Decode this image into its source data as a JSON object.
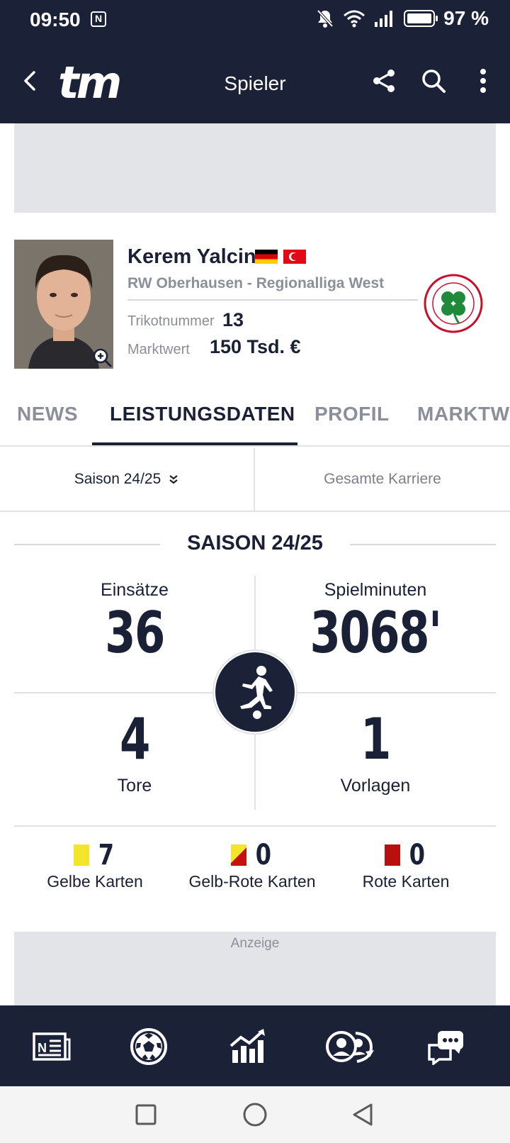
{
  "status": {
    "time": "09:50",
    "nfc": "N",
    "battery": "97 %"
  },
  "app_bar": {
    "logo": "tm",
    "title": "Spieler"
  },
  "player": {
    "name": "Kerem Yalcin",
    "club": "RW Oberhausen - Regionalliga West",
    "shirt_label": "Trikotnummer",
    "shirt_number": "13",
    "market_label": "Marktwert",
    "market_value": "150 Tsd. €"
  },
  "tabs": [
    {
      "label": "NEWS"
    },
    {
      "label": "LEISTUNGSDATEN"
    },
    {
      "label": "PROFIL"
    },
    {
      "label": "MARKTW"
    }
  ],
  "season_selector": {
    "current": "Saison 24/25",
    "career": "Gesamte Karriere"
  },
  "section_title": "SAISON 24/25",
  "stats": {
    "appearances_label": "Einsätze",
    "appearances": "36",
    "minutes_label": "Spielminuten",
    "minutes": "3068'",
    "goals": "4",
    "goals_label": "Tore",
    "assists": "1",
    "assists_label": "Vorlagen"
  },
  "cards": {
    "yellow": "7",
    "yellow_label": "Gelbe Karten",
    "yellow_red": "0",
    "yellow_red_label": "Gelb-Rote Karten",
    "red": "0",
    "red_label": "Rote Karten"
  },
  "ad": {
    "label": "Anzeige"
  },
  "colors": {
    "navy": "#1b2137",
    "muted": "#8b8f99",
    "yellow_card": "#f3e52b",
    "red_card": "#b7100f"
  }
}
